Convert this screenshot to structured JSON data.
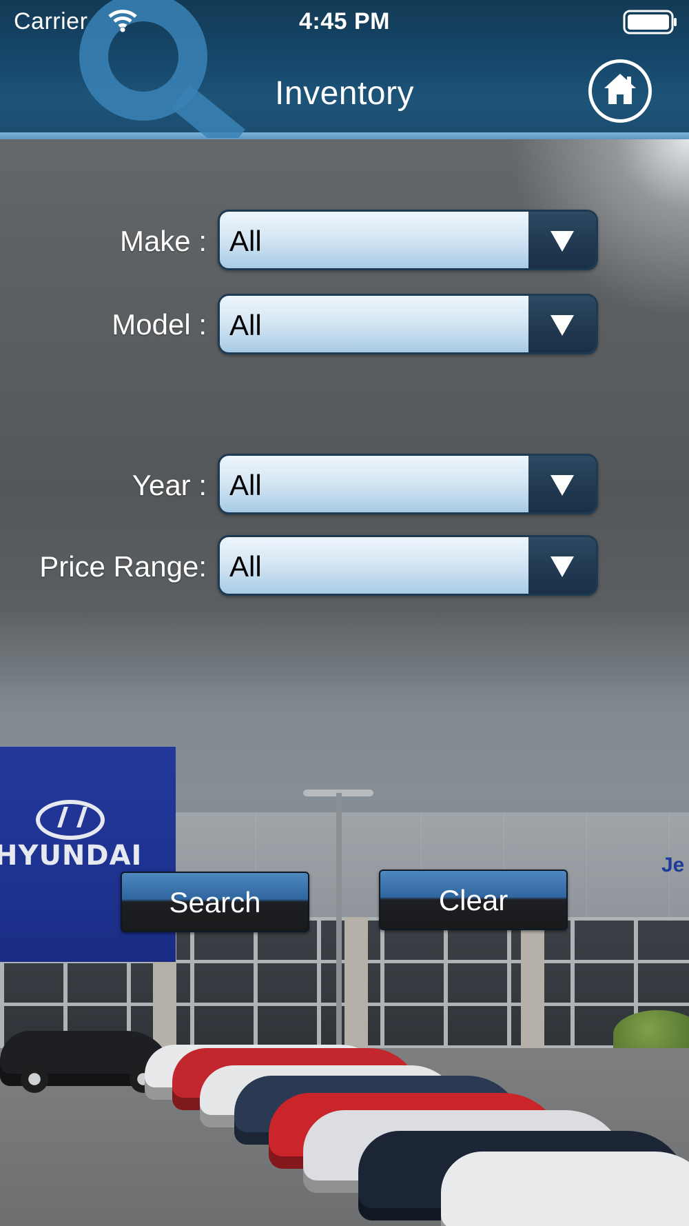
{
  "status_bar": {
    "carrier": "Carrier",
    "time": "4:45 PM",
    "wifi_icon": "wifi-icon",
    "battery_icon": "battery-full-icon"
  },
  "nav": {
    "title": "Inventory",
    "decor_icon": "magnifier-icon",
    "home_icon": "home-icon",
    "bar_color": "#16476a",
    "accent_color": "#7db3d8"
  },
  "form": {
    "make": {
      "label": "Make :",
      "value": "All"
    },
    "model": {
      "label": "Model :",
      "value": "All"
    },
    "year": {
      "label": "Year :",
      "value": "All"
    },
    "price_range": {
      "label": "Price Range:",
      "value": "All"
    },
    "dropdown_icon": "triangle-down-icon"
  },
  "actions": {
    "search_label": "Search",
    "clear_label": "Clear"
  },
  "background": {
    "dealer_sign": "HYUNDAI",
    "building_sign_fragment": "Je"
  }
}
